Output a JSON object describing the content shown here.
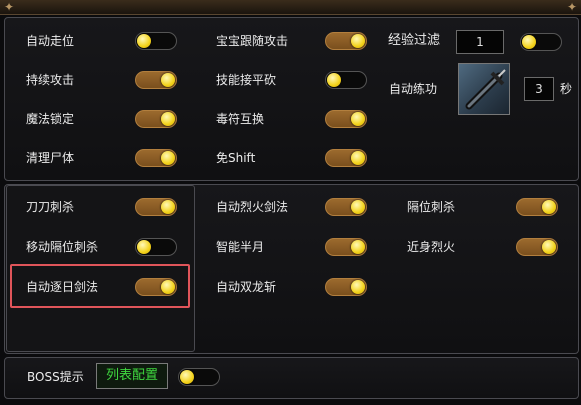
{
  "section1": {
    "col1": [
      {
        "label": "自动走位",
        "on": false
      },
      {
        "label": "持续攻击",
        "on": true
      },
      {
        "label": "魔法锁定",
        "on": true
      },
      {
        "label": "清理尸体",
        "on": true
      }
    ],
    "col2": [
      {
        "label": "宝宝跟随攻击",
        "on": true
      },
      {
        "label": "技能接平砍",
        "on": false
      },
      {
        "label": "毒符互换",
        "on": true
      },
      {
        "label": "免Shift",
        "on": true
      }
    ],
    "exp_filter": {
      "label": "经验过滤",
      "value": "1",
      "on": false
    },
    "auto_practice": {
      "label": "自动练功",
      "value": "3",
      "unit": "秒",
      "icon": "sword-skill-icon"
    }
  },
  "section2": {
    "col1": [
      {
        "label": "刀刀刺杀",
        "on": true
      },
      {
        "label": "移动隔位刺杀",
        "on": false
      },
      {
        "label": "自动逐日剑法",
        "on": true
      }
    ],
    "col2": [
      {
        "label": "自动烈火剑法",
        "on": true
      },
      {
        "label": "智能半月",
        "on": true
      },
      {
        "label": "自动双龙斩",
        "on": true
      }
    ],
    "col3": [
      {
        "label": "隔位刺杀",
        "on": true
      },
      {
        "label": "近身烈火",
        "on": true
      }
    ]
  },
  "boss": {
    "label": "BOSS提示",
    "button": "列表配置",
    "on": false
  },
  "colors": {
    "accent": "#9b6a2e",
    "knob": "#f3d21a",
    "highlight": "#e0555a",
    "button_text": "#3fd83f"
  }
}
